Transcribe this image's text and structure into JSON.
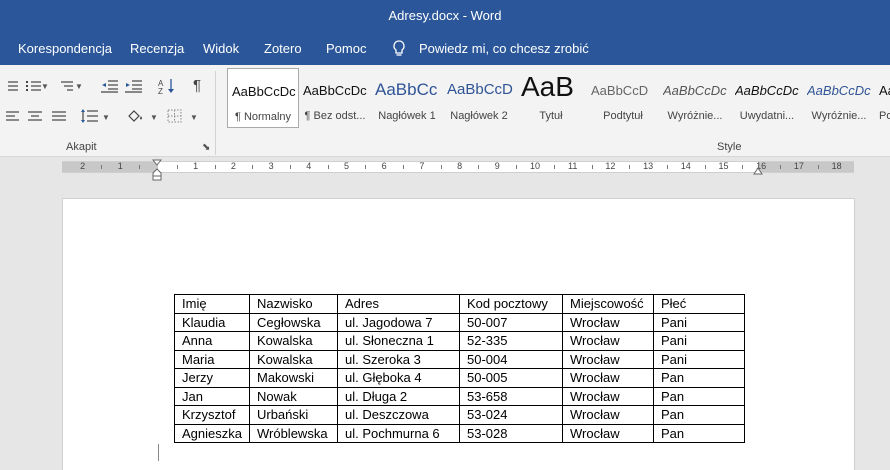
{
  "window": {
    "title": "Adresy.docx  -  Word"
  },
  "menu": {
    "tabs": [
      "Korespondencja",
      "Recenzja",
      "Widok",
      "Zotero",
      "Pomoc"
    ],
    "tell_me": "Powiedz mi, co chcesz zrobić"
  },
  "ribbon": {
    "paragraph_group": "Akapit",
    "styles_group": "Style",
    "styles": [
      {
        "preview": "AaBbCcDc",
        "name": "¶ Normalny",
        "selected": true
      },
      {
        "preview": "AaBbCcDc",
        "name": "¶ Bez odst..."
      },
      {
        "preview": "AaBbCc",
        "name": "Nagłówek 1"
      },
      {
        "preview": "AaBbCcD",
        "name": "Nagłówek 2"
      },
      {
        "preview": "AaB",
        "name": "Tytuł"
      },
      {
        "preview": "AaBbCcD",
        "name": "Podtytuł"
      },
      {
        "preview": "AaBbCcDc",
        "name": "Wyróżnie..."
      },
      {
        "preview": "AaBbCcDc",
        "name": "Uwydatni..."
      },
      {
        "preview": "AaBbCcDc",
        "name": "Wyróżnie..."
      },
      {
        "preview": "AaB",
        "name": "Po"
      }
    ]
  },
  "ruler": {
    "numbers": [
      "2",
      "1",
      "1",
      "2",
      "3",
      "4",
      "5",
      "6",
      "7",
      "8",
      "9",
      "10",
      "11",
      "12",
      "13",
      "14",
      "15",
      "16",
      "17",
      "18"
    ]
  },
  "table": {
    "headers": [
      "Imię",
      "Nazwisko",
      "Adres",
      "Kod pocztowy",
      "Miejscowość",
      "Płeć"
    ],
    "rows": [
      [
        "Klaudia",
        "Cegłowska",
        "ul. Jagodowa 7",
        "50-007",
        "Wrocław",
        "Pani"
      ],
      [
        "Anna",
        "Kowalska",
        "ul. Słoneczna 1",
        "52-335",
        "Wrocław",
        "Pani"
      ],
      [
        "Maria",
        "Kowalska",
        "ul. Szeroka 3",
        "50-004",
        "Wrocław",
        "Pani"
      ],
      [
        "Jerzy",
        "Makowski",
        "ul. Głęboka 4",
        "50-005",
        "Wrocław",
        "Pan"
      ],
      [
        "Jan",
        "Nowak",
        "ul. Długa 2",
        "53-658",
        "Wrocław",
        "Pan"
      ],
      [
        "Krzysztof",
        "Urbański",
        "ul. Deszczowa",
        "53-024",
        "Wrocław",
        "Pan"
      ],
      [
        "Agnieszka",
        "Wróblewska",
        "ul. Pochmurna 6",
        "53-028",
        "Wrocław",
        "Pan"
      ]
    ]
  },
  "colors": {
    "titlebar": "#2b579a",
    "ribbon": "#f3f3f3",
    "workspace": "#e6e6e6",
    "heading_blue": "#2f5496"
  }
}
